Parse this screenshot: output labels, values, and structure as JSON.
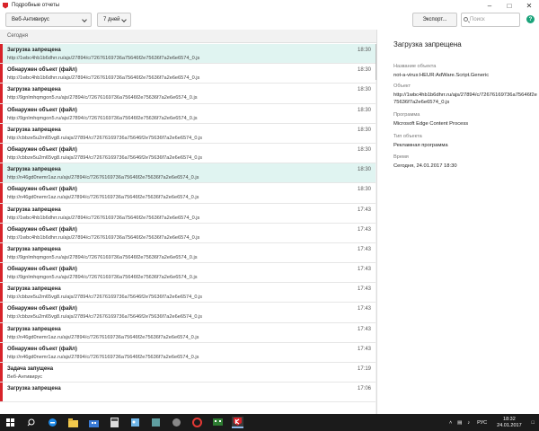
{
  "window": {
    "title": "Подробные отчеты"
  },
  "toolbar": {
    "component_filter": "Веб-Антивирус",
    "period_filter": "7 дней",
    "export_label": "Экспорт...",
    "search_placeholder": "Поиск"
  },
  "list": {
    "group_header": "Сегодня",
    "rows": [
      {
        "title": "Загрузка запрещена",
        "detail": "http://1wbc4hb1b6dhrr.ru/ajs/27894/c/72676169736a75646f2e75636f7a2e6e6574_0.js",
        "time": "18:30",
        "selected": true
      },
      {
        "title": "Обнаружен объект (файл)",
        "detail": "http://1wbc4hb1b6dhrr.ru/ajs/27894/c/72676169736a75646f2e75636f7a2e6e6574_0.js",
        "time": "18:30",
        "selected": false
      },
      {
        "title": "Загрузка запрещена",
        "detail": "http://9gnlmhqmgon5.ru/ajs/27894/c/72676169736a75646f2e75636f7a2e6e6574_0.js",
        "time": "18:30",
        "selected": false
      },
      {
        "title": "Обнаружен объект (файл)",
        "detail": "http://9gnlmhqmgon5.ru/ajs/27894/c/72676169736a75646f2e75636f7a2e6e6574_0.js",
        "time": "18:30",
        "selected": false
      },
      {
        "title": "Загрузка запрещена",
        "detail": "http://cbbze5u2m65vg8.ru/ajs/27894/c/72676169736a75646f2e75636f7a2e6e6574_0.js",
        "time": "18:30",
        "selected": false
      },
      {
        "title": "Обнаружен объект (файл)",
        "detail": "http://cbbze5u2m65vg8.ru/ajs/27894/c/72676169736a75646f2e75636f7a2e6e6574_0.js",
        "time": "18:30",
        "selected": false
      },
      {
        "title": "Загрузка запрещена",
        "detail": "http://n46gd0nemr1az.ru/ajs/27894/c/72676169736a75646f2e75636f7a2e6e6574_0.js",
        "time": "18:30",
        "selected": true
      },
      {
        "title": "Обнаружен объект (файл)",
        "detail": "http://n46gd0nemr1az.ru/ajs/27894/c/72676169736a75646f2e75636f7a2e6e6574_0.js",
        "time": "18:30",
        "selected": false
      },
      {
        "title": "Загрузка запрещена",
        "detail": "http://1wbc4hb1b6dhrr.ru/ajs/27894/c/72676169736a75646f2e75636f7a2e6e6574_0.js",
        "time": "17:43",
        "selected": false
      },
      {
        "title": "Обнаружен объект (файл)",
        "detail": "http://1wbc4hb1b6dhrr.ru/ajs/27894/c/72676169736a75646f2e75636f7a2e6e6574_0.js",
        "time": "17:43",
        "selected": false
      },
      {
        "title": "Загрузка запрещена",
        "detail": "http://9gnlmhqmgon5.ru/ajs/27894/c/72676169736a75646f2e75636f7a2e6e6574_0.js",
        "time": "17:43",
        "selected": false
      },
      {
        "title": "Обнаружен объект (файл)",
        "detail": "http://9gnlmhqmgon5.ru/ajs/27894/c/72676169736a75646f2e75636f7a2e6e6574_0.js",
        "time": "17:43",
        "selected": false
      },
      {
        "title": "Загрузка запрещена",
        "detail": "http://cbbze5u2m65vg8.ru/ajs/27894/c/72676169736a75646f2e75636f7a2e6e6574_0.js",
        "time": "17:43",
        "selected": false
      },
      {
        "title": "Обнаружен объект (файл)",
        "detail": "http://cbbze5u2m65vg8.ru/ajs/27894/c/72676169736a75646f2e75636f7a2e6e6574_0.js",
        "time": "17:43",
        "selected": false
      },
      {
        "title": "Загрузка запрещена",
        "detail": "http://n46gd0nemr1az.ru/ajs/27894/c/72676169736a75646f2e75636f7a2e6e6574_0.js",
        "time": "17:43",
        "selected": false
      },
      {
        "title": "Обнаружен объект (файл)",
        "detail": "http://n46gd0nemr1az.ru/ajs/27894/c/72676169736a75646f2e75636f7a2e6e6574_0.js",
        "time": "17:43",
        "selected": false
      },
      {
        "title": "Задача запущена",
        "detail": "Веб-Антивирус",
        "time": "17:19",
        "selected": false
      },
      {
        "title": "Загрузка запрещена",
        "detail": "",
        "time": "17:06",
        "selected": false
      }
    ]
  },
  "detail": {
    "heading": "Загрузка запрещена",
    "fields": [
      {
        "label": "Название объекта",
        "value": "not-a-virus:HEUR:AdWare.Script.Generic"
      },
      {
        "label": "Объект",
        "value": "http://1wbc4hb1b6dhrr.ru/ajs/27894/c/72676169736a75646f2e75636f7a2e6e6574_0.js"
      },
      {
        "label": "Программа",
        "value": "Microsoft Edge Content Process"
      },
      {
        "label": "Тип объекта",
        "value": "Рекламная программа"
      },
      {
        "label": "Время",
        "value": "Сегодня, 24.01.2017 18:30"
      }
    ]
  },
  "taskbar": {
    "clock_time": "18:32",
    "clock_date": "24.01.2017",
    "language": "РУС",
    "apps": [
      "search-icon",
      "task-view-icon",
      "edge-icon",
      "explorer-icon",
      "store-icon",
      "calculator-icon",
      "paint-icon",
      "opera-icon",
      "media-icon",
      "kaspersky-icon"
    ]
  },
  "colors": {
    "accent_red": "#d8232a",
    "selected_row": "#e0f4f1",
    "help_green": "#1aa37a",
    "taskbar": "#1b1b1b"
  }
}
